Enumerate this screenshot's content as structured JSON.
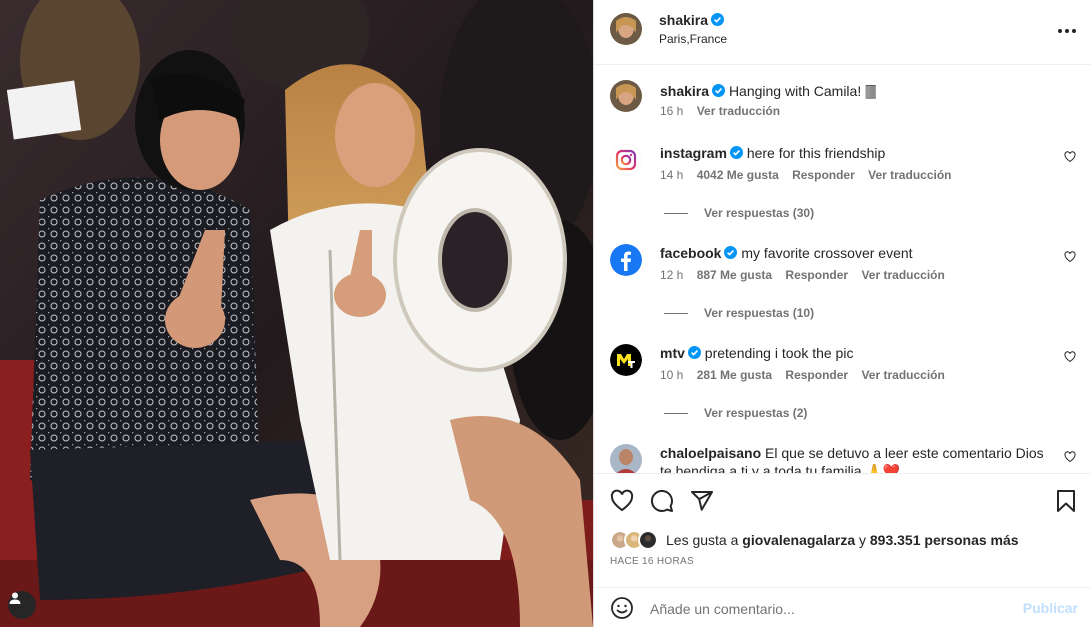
{
  "colors": {
    "accent": "#0095f6",
    "publish_disabled": "#c0dffd",
    "verified": "#0095f6",
    "muted": "#737373",
    "text": "#262626"
  },
  "photo": {
    "description_icon": "user-tag-icon"
  },
  "header": {
    "username": "shakira",
    "location": "Paris,France",
    "more_icon": "more-horizontal-icon"
  },
  "caption": {
    "username": "shakira",
    "text": "Hanging with Camila! 🀫",
    "time": "16 h",
    "translate": "Ver traducción"
  },
  "comments": [
    {
      "username": "instagram",
      "text": "here for this friendship",
      "time": "14 h",
      "likes": "4042 Me gusta",
      "reply": "Responder",
      "translate": "Ver traducción",
      "replies": "Ver respuestas (30)"
    },
    {
      "username": "facebook",
      "text": "my favorite crossover event",
      "time": "12 h",
      "likes": "887 Me gusta",
      "reply": "Responder",
      "translate": "Ver traducción",
      "replies": "Ver respuestas (10)"
    },
    {
      "username": "mtv",
      "text": "pretending i took the pic",
      "time": "10 h",
      "likes": "281 Me gusta",
      "reply": "Responder",
      "translate": "Ver traducción",
      "replies": "Ver respuestas (2)"
    },
    {
      "username": "chaloelpaisano",
      "text": "El que se detuvo a leer este comentario Dios te bendiga a ti y a toda tu familia 🙏❤️"
    }
  ],
  "likes": {
    "prefix": "Les gusta a",
    "user": "giovalenagalarza",
    "joiner": "y",
    "count": "893.351 personas más"
  },
  "time_ago": "HACE 16 HORAS",
  "add_comment": {
    "placeholder": "Añade un comentario...",
    "publish": "Publicar"
  }
}
